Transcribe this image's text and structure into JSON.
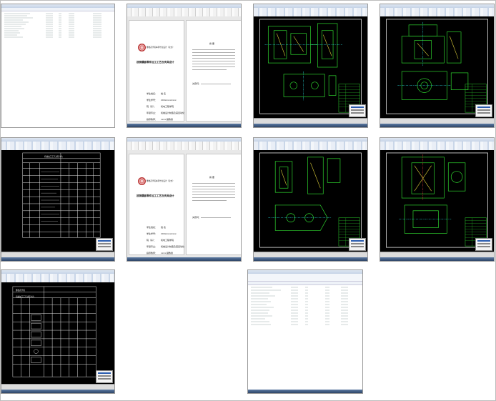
{
  "tiles": [
    {
      "id": "tile-file-list-1",
      "type": "explorer"
    },
    {
      "id": "tile-word-cover-1",
      "type": "word"
    },
    {
      "id": "tile-cad-assembly-1",
      "type": "cad"
    },
    {
      "id": "tile-cad-assembly-2",
      "type": "cad"
    },
    {
      "id": "tile-cad-process-card-1",
      "type": "cad"
    },
    {
      "id": "tile-word-cover-2",
      "type": "word"
    },
    {
      "id": "tile-cad-assembly-3",
      "type": "cad"
    },
    {
      "id": "tile-cad-assembly-4",
      "type": "cad"
    },
    {
      "id": "tile-cad-process-card-2",
      "type": "cad"
    },
    {
      "id": "tile-file-list-2",
      "type": "explorer"
    }
  ],
  "word_cover": {
    "school": "攀枝花学院本科毕业设计（论文）",
    "title": "拔销镶套零件加工工艺及夹具设计",
    "fields": [
      "学生姓名：",
      "学生学号：",
      "院（系）：",
      "年级专业：",
      "指导教师："
    ],
    "values": [
      "姓  名",
      "200xxxxxxxxx",
      "机电工程学院",
      "机械设计制造及其自动化",
      "xxxx  副教授"
    ],
    "abstract_heading": "摘    要",
    "keywords_label": "关键词："
  },
  "process_card": {
    "title": "机械加工工艺过程卡片",
    "school": "攀枝花学院"
  },
  "colors": {
    "cad_bg": "#000000",
    "cad_green": "#2fd62f",
    "cad_white": "#e6e6e6",
    "cad_cyan": "#27c3c3",
    "cad_yellow": "#e0d23a",
    "cad_red": "#d43a3a",
    "taskbar": "#2d4466"
  }
}
